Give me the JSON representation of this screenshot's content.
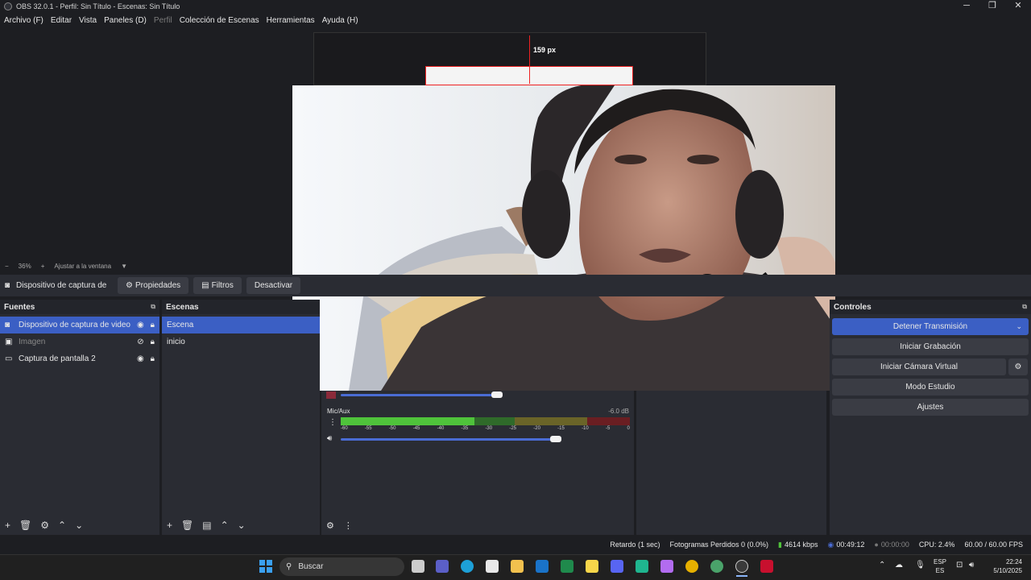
{
  "window": {
    "title": "OBS 32.0.1 - Perfil: Sin Título - Escenas: Sin Título",
    "controls": [
      "─",
      "❐",
      "✕"
    ]
  },
  "menu": [
    "Archivo (F)",
    "Editar",
    "Vista",
    "Paneles (D)",
    "Perfil",
    "Colección de Escenas",
    "Herramientas",
    "Ayuda (H)"
  ],
  "preview": {
    "measure_label": "159 px"
  },
  "zoom": {
    "minus": "−",
    "level": "36%",
    "plus": "+",
    "fit": "Ajustar a la ventana",
    "arrow": "▼"
  },
  "source_toolbar": {
    "source_name": "Dispositivo de captura de v",
    "properties": "Propiedades",
    "filters": "Filtros",
    "deactivate": "Desactivar"
  },
  "sources": {
    "title": "Fuentes",
    "items": [
      {
        "label": "Dispositivo de captura de video",
        "selected": true,
        "hidden": false
      },
      {
        "label": "Imagen",
        "selected": false,
        "hidden": true
      },
      {
        "label": "Captura de pantalla 2",
        "selected": false,
        "hidden": false
      }
    ]
  },
  "scenes": {
    "title": "Escenas",
    "items": [
      {
        "label": "Escena",
        "selected": true
      },
      {
        "label": "inicio",
        "selected": false
      }
    ]
  },
  "mixer": {
    "channel": "Mic/Aux",
    "db": "-6.0 dB",
    "ticks": [
      "-60",
      "-55",
      "-50",
      "-45",
      "-40",
      "-35",
      "-30",
      "-25",
      "-20",
      "-15",
      "-10",
      "-5",
      "0"
    ]
  },
  "controls": {
    "title": "Controles",
    "stop_stream": "Detener Transmisión",
    "start_record": "Iniciar Grabación",
    "virtual_cam": "Iniciar Cámara Virtual",
    "studio_mode": "Modo Estudio",
    "settings": "Ajustes"
  },
  "status": {
    "delay": "Retardo (1 sec)",
    "dropped": "Fotogramas Perdidos 0 (0.0%)",
    "bitrate": "4614 kbps",
    "stream_time": "00:49:12",
    "rec_time": "00:00:00",
    "cpu": "CPU: 2.4%",
    "fps": "60.00 / 60.00 FPS"
  },
  "taskbar": {
    "search": "Buscar",
    "lang_top": "ESP",
    "lang_bottom": "ES",
    "time": "22:24",
    "date": "5/10/2025"
  },
  "colors": {
    "accent": "#3b5fc4",
    "panel": "#2a2c33",
    "background": "#1d1e22",
    "meter_green": "#4fc33b",
    "meter_yellow": "#c0b33a",
    "meter_red": "#c02a2a"
  }
}
